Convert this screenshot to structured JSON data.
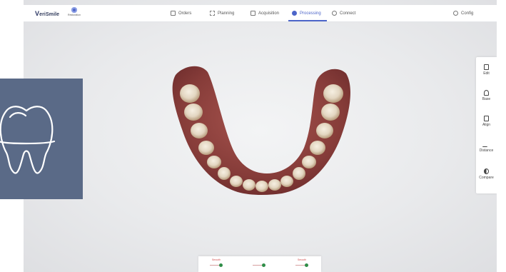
{
  "header": {
    "logo_mark": "V",
    "logo_text": "eriSmile",
    "sub_app_label": "Restoration"
  },
  "nav": {
    "orders": "Orders",
    "planning": "Planning",
    "acquisition": "Acquisition",
    "processing": "Processing",
    "connect": "Connect",
    "config": "Config",
    "active_tab": "Processing"
  },
  "tools": [
    {
      "label": "Edit",
      "icon": "edit-icon"
    },
    {
      "label": "Base",
      "icon": "base-icon"
    },
    {
      "label": "Align",
      "icon": "align-icon"
    },
    {
      "label": "Distance",
      "icon": "distance-icon"
    },
    {
      "label": "Compare",
      "icon": "compare-icon"
    }
  ],
  "bottom_toggles": [
    {
      "label": "Smooth",
      "state": "on"
    },
    {
      "label": "",
      "state": "on"
    },
    {
      "label": "Smooth",
      "state": "on"
    }
  ],
  "thumbnail": {
    "icon": "tooth-icon"
  },
  "colors": {
    "accent": "#4d65c9",
    "thumbnail_bg": "#5a6a87",
    "gum": "#8a3e3b",
    "toggle_on": "#2f8d48"
  }
}
